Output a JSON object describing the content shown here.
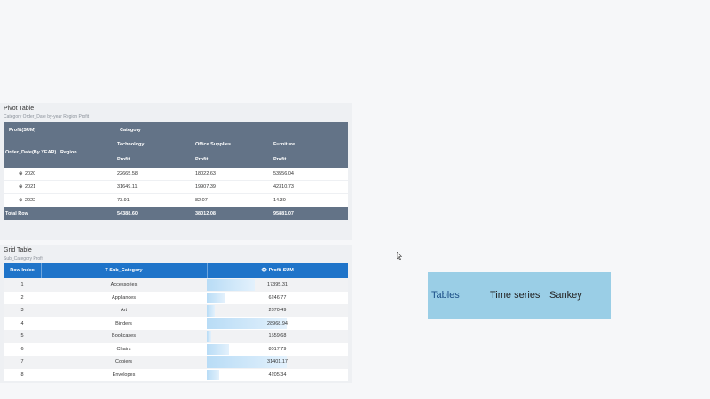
{
  "pivot": {
    "title": "Pivot Table",
    "subtitle": "Category Order_Date by-year Region Profit",
    "corner_label": "Profit(SUM)",
    "column_dim_label": "Category",
    "row_dim_labels": [
      "Order_Date(By YEAR)",
      "Region"
    ],
    "categories": [
      "Technology",
      "Office Supplies",
      "Furniture"
    ],
    "measure_label": "Profit",
    "rows": [
      {
        "year": "2020",
        "values": [
          "22665.58",
          "18022.63",
          "53556.04"
        ]
      },
      {
        "year": "2021",
        "values": [
          "31649.11",
          "19907.39",
          "42310.73"
        ]
      },
      {
        "year": "2022",
        "values": [
          "73.91",
          "82.07",
          "14.30"
        ]
      }
    ],
    "total": {
      "label": "Total Row",
      "values": [
        "54388.60",
        "38012.08",
        "95881.07"
      ]
    },
    "expand_icon": "plus-circle-icon"
  },
  "grid": {
    "title": "Grid Table",
    "subtitle": "Sub_Category Profit",
    "headers": {
      "index": "Row Index",
      "sub_category": "Sub_Category",
      "profit": "Profit SUM"
    },
    "header_icons": {
      "sub_category": "text-type-icon",
      "profit": "eye-icon"
    },
    "bar_color": "#b8dcf6",
    "rows": [
      {
        "index": "1",
        "sub_category": "Accessories",
        "profit": "17395.31",
        "share": 0.6
      },
      {
        "index": "2",
        "sub_category": "Appliances",
        "profit": "6246.77",
        "share": 0.22
      },
      {
        "index": "3",
        "sub_category": "Art",
        "profit": "2870.49",
        "share": 0.1
      },
      {
        "index": "4",
        "sub_category": "Binders",
        "profit": "28968.94",
        "share": 1.0
      },
      {
        "index": "5",
        "sub_category": "Bookcases",
        "profit": "1559.68",
        "share": 0.05
      },
      {
        "index": "6",
        "sub_category": "Chairs",
        "profit": "8017.79",
        "share": 0.28
      },
      {
        "index": "7",
        "sub_category": "Copiers",
        "profit": "31401.17",
        "share": 1.0
      },
      {
        "index": "8",
        "sub_category": "Envelopes",
        "profit": "4205.34",
        "share": 0.15
      }
    ]
  },
  "tabs": {
    "items": [
      "Tables",
      "Time series",
      "Sankey"
    ],
    "background": "#9acee6"
  }
}
